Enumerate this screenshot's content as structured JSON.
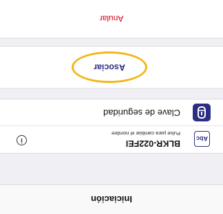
{
  "nav": {
    "title": "Iniciación"
  },
  "device": {
    "badge": "Abc",
    "name": "BLKR-022FEI",
    "hint": "Pulse para cambiar el nombre",
    "info_icon": "info-circle-icon"
  },
  "security_key": {
    "label": "Clave de seguridad",
    "icon": "remote-key-icon"
  },
  "actions": {
    "associate_label": "Asociar",
    "cancel_label": "Anular"
  },
  "colors": {
    "brand": "#2d2e83",
    "highlight_ring": "#f3b617",
    "cancel": "#d0021b"
  }
}
